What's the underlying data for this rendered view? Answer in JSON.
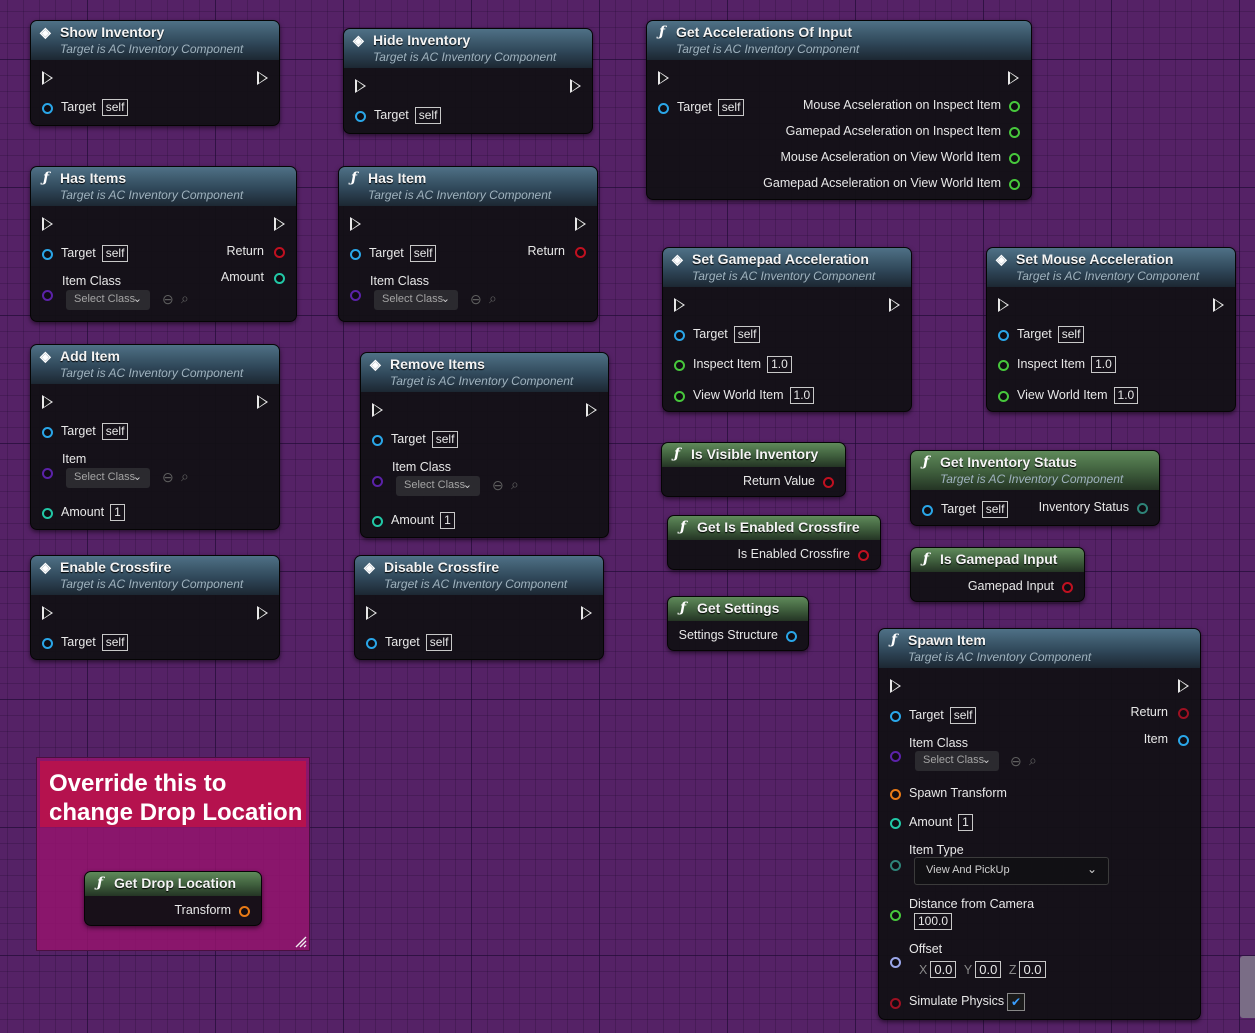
{
  "target_sub": "Target is AC Inventory Component",
  "self": "self",
  "pins": {
    "target": "Target",
    "return": "Return",
    "amount": "Amount",
    "item_class": "Item Class",
    "item": "Item",
    "inspect_item": "Inspect Item",
    "view_world_item": "View World Item"
  },
  "select_class": "Select Class",
  "values": {
    "one_float": "1.0",
    "one_int": "1"
  },
  "nodes": {
    "show_inventory": "Show Inventory",
    "hide_inventory": "Hide Inventory",
    "get_accelerations": "Get Accelerations Of Input",
    "has_items": "Has Items",
    "has_item": "Has Item",
    "set_gamepad_accel": "Set Gamepad Acceleration",
    "set_mouse_accel": "Set Mouse Acceleration",
    "add_item": "Add Item",
    "remove_items": "Remove Items",
    "is_visible_inventory": "Is Visible Inventory",
    "get_inventory_status": "Get Inventory Status",
    "get_is_enabled_crossfire": "Get Is Enabled Crossfire",
    "enable_crossfire": "Enable Crossfire",
    "disable_crossfire": "Disable Crossfire",
    "is_gamepad_input": "Is Gamepad Input",
    "get_settings": "Get Settings",
    "spawn_item": "Spawn Item",
    "get_drop_location": "Get Drop Location"
  },
  "accel_outputs": [
    "Mouse Acseleration on Inspect Item",
    "Gamepad Acseleration on Inspect Item",
    "Mouse Acseleration on View World Item",
    "Gamepad Acseleration on View World Item"
  ],
  "outputs": {
    "return_value": "Return Value",
    "inventory_status": "Inventory Status",
    "is_enabled_crossfire": "Is Enabled Crossfire",
    "gamepad_input": "Gamepad Input",
    "settings_structure": "Settings Structure",
    "transform": "Transform"
  },
  "spawn": {
    "spawn_transform": "Spawn Transform",
    "item_type": "Item Type",
    "item_type_value": "View And PickUp",
    "distance_label": "Distance from Camera",
    "distance_value": "100.0",
    "offset": "Offset",
    "x": "X",
    "y": "Y",
    "z": "Z",
    "x_val": "0.0",
    "y_val": "0.0",
    "z_val": "0.0",
    "simulate_physics": "Simulate Physics",
    "simulate_physics_checked": true
  },
  "comment": {
    "text": "Override this to change Drop Location"
  },
  "colors": {
    "graph_bg": "#552266",
    "exec": "#e8e8e8",
    "object_pin": "#2aa6e8",
    "float_pin": "#47c73c",
    "bool_pin": "#c01020",
    "int_pin": "#22c7a6",
    "class_pin": "#5b22a8",
    "transform_pin": "#e87a16",
    "comment": "#b5124e"
  }
}
